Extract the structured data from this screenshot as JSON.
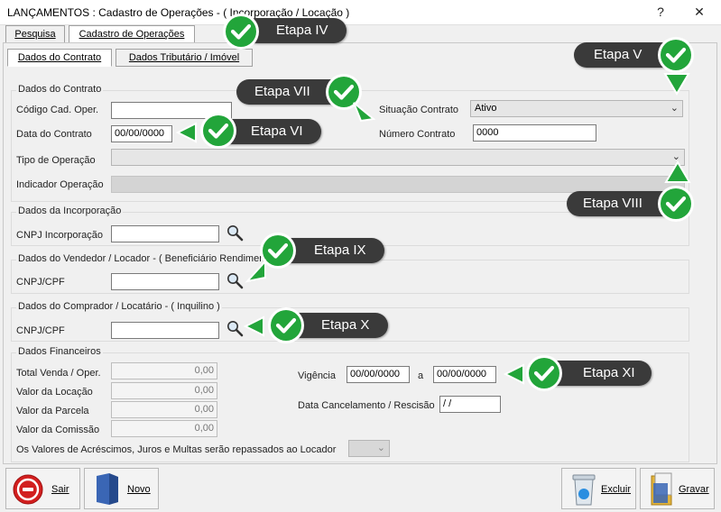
{
  "window": {
    "title": "LANÇAMENTOS : Cadastro de Operações - ( Incorporação / Locação )",
    "help": "?",
    "close": "✕"
  },
  "top_tabs": [
    {
      "label": "Pesquisa"
    },
    {
      "label": "Cadastro de Operações"
    }
  ],
  "sub_tabs": [
    {
      "label": "Dados do Contrato"
    },
    {
      "label": "Dados Tributário  /  Imóvel"
    }
  ],
  "contrato": {
    "group_title": "Dados do Contrato",
    "codigo_label": "Código Cad. Oper.",
    "codigo_value": "",
    "data_label": "Data do Contrato",
    "data_value": "00/00/0000",
    "situacao_label": "Situação Contrato",
    "situacao_value": "Ativo",
    "numero_label": "Número Contrato",
    "numero_value": "0000",
    "tipo_label": "Tipo de Operação",
    "tipo_value": "",
    "indicador_label": "Indicador Operação",
    "indicador_value": ""
  },
  "incorporacao": {
    "group_title": "Dados da Incorporação",
    "cnpj_label": "CNPJ Incorporação",
    "cnpj_value": ""
  },
  "vendedor": {
    "group_title": "Dados do Vendedor  /  Locador - ( Beneficiário Rendimento )",
    "cnpj_label": "CNPJ/CPF",
    "cnpj_value": ""
  },
  "comprador": {
    "group_title": "Dados do Comprador  /  Locatário - ( Inquilino )",
    "cnpj_label": "CNPJ/CPF",
    "cnpj_value": ""
  },
  "financeiros": {
    "group_title": "Dados Financeiros",
    "total_label": "Total Venda / Oper.",
    "total_value": "0,00",
    "locacao_label": "Valor da Locação",
    "locacao_value": "0,00",
    "parcela_label": "Valor da Parcela",
    "parcela_value": "0,00",
    "comissao_label": "Valor da Comissão",
    "comissao_value": "0,00",
    "vigencia_label": "Vigência",
    "vigencia_inicio": "00/00/0000",
    "vigencia_sep": "a",
    "vigencia_fim": "00/00/0000",
    "cancelamento_label": "Data Cancelamento / Rescisão",
    "cancelamento_value": " /  /",
    "repasse_label": "Os Valores de Acréscimos, Juros e Multas serão repassados ao Locador",
    "repasse_value": ""
  },
  "buttons": {
    "sair": "Sair",
    "novo": "Novo",
    "excluir": "Excluir",
    "gravar": "Gravar"
  },
  "callouts": [
    {
      "label": "Etapa IV"
    },
    {
      "label": "Etapa V"
    },
    {
      "label": "Etapa VII"
    },
    {
      "label": "Etapa VI"
    },
    {
      "label": "Etapa VIII"
    },
    {
      "label": "Etapa IX"
    },
    {
      "label": "Etapa X"
    },
    {
      "label": "Etapa XI"
    }
  ],
  "colors": {
    "callout_bg": "#3a3a3a",
    "check_green": "#22a53a",
    "sair_red": "#d21f1f",
    "novo_blue": "#3a66b5"
  }
}
